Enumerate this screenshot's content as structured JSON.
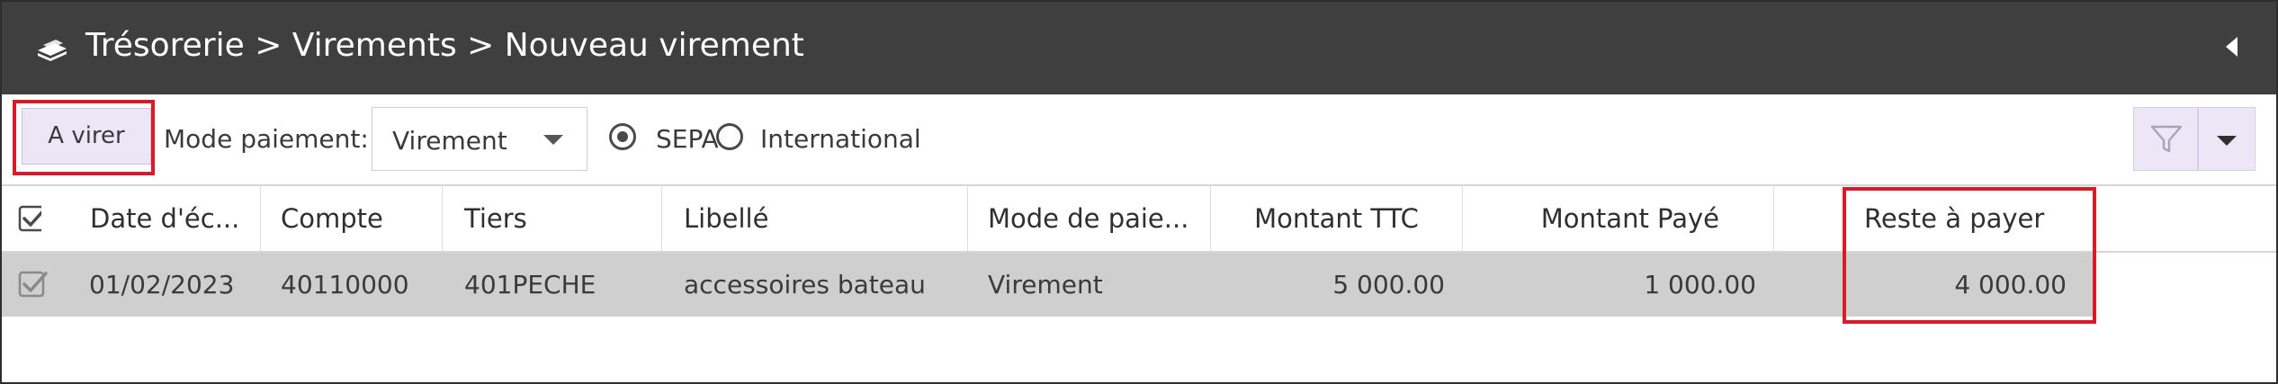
{
  "header": {
    "title": "Trésorerie > Virements > Nouveau virement",
    "icon": "money-stack-icon",
    "collapse_icon": "collapse-left-icon",
    "background": "#3f3f3f"
  },
  "toolbar": {
    "a_virer_label": "A virer",
    "mode_paiement_label": "Mode paiement:",
    "mode_paiement_value": "Virement",
    "radio_sepa_label": "SEPA",
    "radio_international_label": "International",
    "selected_radio": "SEPA",
    "filter_icon": "filter-icon",
    "dropdown_icon": "caret-down-icon",
    "button_color": "#ece6f7"
  },
  "table": {
    "columns": [
      "Date d'éc...",
      "Compte",
      "Tiers",
      "Libellé",
      "Mode de paie...",
      "Montant TTC",
      "Montant Payé",
      "Reste à payer"
    ],
    "rows": [
      {
        "checked": true,
        "date": "01/02/2023",
        "compte": "40110000",
        "tiers": "401PECHE",
        "libelle": "accessoires bateau",
        "mode": "Virement",
        "montant_ttc": "5 000.00",
        "montant_paye": "1 000.00",
        "reste_a_payer": "4 000.00"
      }
    ],
    "row_background": "#cfcfcf"
  },
  "highlight_color": "#d81a2a"
}
